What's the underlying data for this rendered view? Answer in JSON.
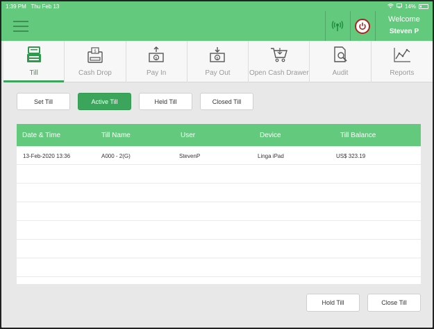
{
  "status": {
    "time": "1:39 PM",
    "date": "Thu Feb 13",
    "battery": "14%"
  },
  "header": {
    "welcome": "Welcome",
    "user": "Steven P"
  },
  "nav": [
    {
      "label": "Till",
      "icon": "till-drawer-icon",
      "active": true
    },
    {
      "label": "Cash Drop",
      "icon": "cash-drop-icon"
    },
    {
      "label": "Pay In",
      "icon": "pay-in-icon"
    },
    {
      "label": "Pay Out",
      "icon": "pay-out-icon"
    },
    {
      "label": "Open Cash Drawer",
      "icon": "cart-icon"
    },
    {
      "label": "Audit",
      "icon": "audit-icon"
    },
    {
      "label": "Reports",
      "icon": "reports-chart-icon"
    }
  ],
  "tabs": {
    "set": "Set Till",
    "active": "Active Till",
    "held": "Held Till",
    "closed": "Closed Till",
    "selected": "Active Till"
  },
  "table": {
    "headers": [
      "Date & Time",
      "Till Name",
      "User",
      "Device",
      "Till Balance"
    ],
    "rows": [
      [
        "13-Feb-2020 13:36",
        "A000 - 2(G)",
        "StevenP",
        "Linga iPad",
        "US$ 323.19"
      ]
    ]
  },
  "actions": {
    "hold": "Hold Till",
    "close": "Close Till"
  },
  "colors": {
    "green": "#63c97d",
    "accent": "#3aa55b",
    "power": "#b32020"
  }
}
